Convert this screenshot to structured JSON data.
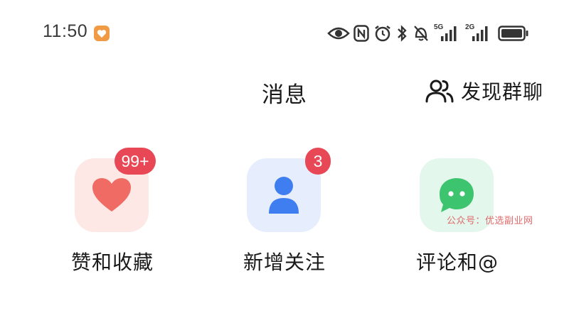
{
  "status_bar": {
    "time": "11:50",
    "icons": [
      "eye-icon",
      "nfc-icon",
      "alarm-icon",
      "bluetooth-icon",
      "mute-icon",
      "signal-5g-icon",
      "signal-2g-icon",
      "battery-icon"
    ],
    "network_1": "5G",
    "network_2": "2G"
  },
  "header": {
    "title": "消息",
    "discover_label": "发现群聊"
  },
  "entries": [
    {
      "label": "赞和收藏",
      "badge": "99+",
      "icon": "heart-icon",
      "tile_bg": "#fde8e6",
      "icon_color": "#ef6b63"
    },
    {
      "label": "新增关注",
      "badge": "3",
      "icon": "person-icon",
      "tile_bg": "#e6eefd",
      "icon_color": "#3f7ef0"
    },
    {
      "label": "评论和@",
      "badge": "",
      "icon": "chat-bubble-icon",
      "tile_bg": "#e4f7ec",
      "icon_color": "#3dc46e"
    }
  ],
  "watermark": "公众号：优选副业网",
  "colors": {
    "badge": "#e84855",
    "text": "#1a1a1a",
    "background": "#ffffff"
  }
}
